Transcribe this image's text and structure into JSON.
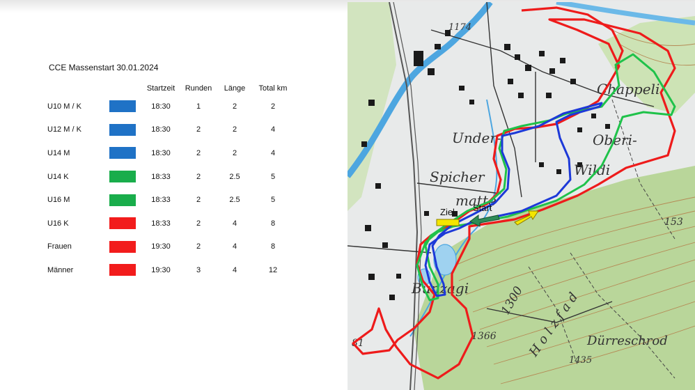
{
  "title": "CCE Massenstart 30.01.2024",
  "table": {
    "headers": [
      "Startzeit",
      "Runden",
      "Länge",
      "Total km"
    ],
    "rows": [
      {
        "category": "U10 M / K",
        "color": "#1f72c6",
        "start": "18:30",
        "runden": "1",
        "laenge": "2",
        "total": "2"
      },
      {
        "category": "U12 M  / K",
        "color": "#1f72c6",
        "start": "18:30",
        "runden": "2",
        "laenge": "2",
        "total": "4"
      },
      {
        "category": "U14 M",
        "color": "#1f72c6",
        "start": "18:30",
        "runden": "2",
        "laenge": "2",
        "total": "4"
      },
      {
        "category": "U14 K",
        "color": "#19ad4b",
        "start": "18:33",
        "runden": "2",
        "laenge": "2.5",
        "total": "5"
      },
      {
        "category": "U16 M",
        "color": "#19ad4b",
        "start": "18:33",
        "runden": "2",
        "laenge": "2.5",
        "total": "5"
      },
      {
        "category": "U16  K",
        "color": "#f21c1c",
        "start": "18:33",
        "runden": "2",
        "laenge": "4",
        "total": "8"
      },
      {
        "category": "Frauen",
        "color": "#f21c1c",
        "start": "19:30",
        "runden": "2",
        "laenge": "4",
        "total": "8"
      },
      {
        "category": "Männer",
        "color": "#f21c1c",
        "start": "19:30",
        "runden": "3",
        "laenge": "4",
        "total": "12"
      }
    ]
  },
  "map": {
    "labels": {
      "elev_1174": "1174",
      "chappeli": "Chappeli",
      "unter": "Under-",
      "oberi": "Oberi-",
      "wildi": "Wildi",
      "spicher": "Spicher",
      "matte": "matte",
      "bunzagi": "Bunzagi",
      "elev_1300": "1300",
      "elev_1366": "1366",
      "holzfad": "Holzfad",
      "duerreschrod": "Dürreschrod",
      "elev_1435": "1435",
      "elev_153": "153",
      "elev_81": "81"
    },
    "ziel_label": "Ziel",
    "start_label": "Start",
    "route_colors": {
      "red": "#ee1b1b",
      "green": "#1fc24a",
      "blue": "#1d39d8",
      "ziel": "#f4e600",
      "start": "#2e8b57"
    }
  }
}
